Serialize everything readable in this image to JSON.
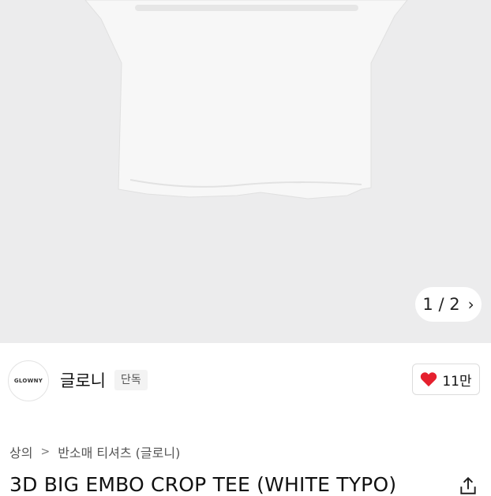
{
  "gallery": {
    "pager_text": "1 / 2",
    "pager_next_icon": "chevron-right-icon"
  },
  "brand": {
    "logo_text": "GLOWNY",
    "name": "글로니",
    "badge": "단독"
  },
  "like": {
    "count": "11만",
    "icon": "heart-icon",
    "color": "#e5202e"
  },
  "breadcrumb": {
    "items": [
      "상의",
      "반소매 티셔츠 (글로니)"
    ]
  },
  "product": {
    "title": "3D BIG EMBO CROP TEE (WHITE TYPO)",
    "share_icon": "share-icon"
  }
}
